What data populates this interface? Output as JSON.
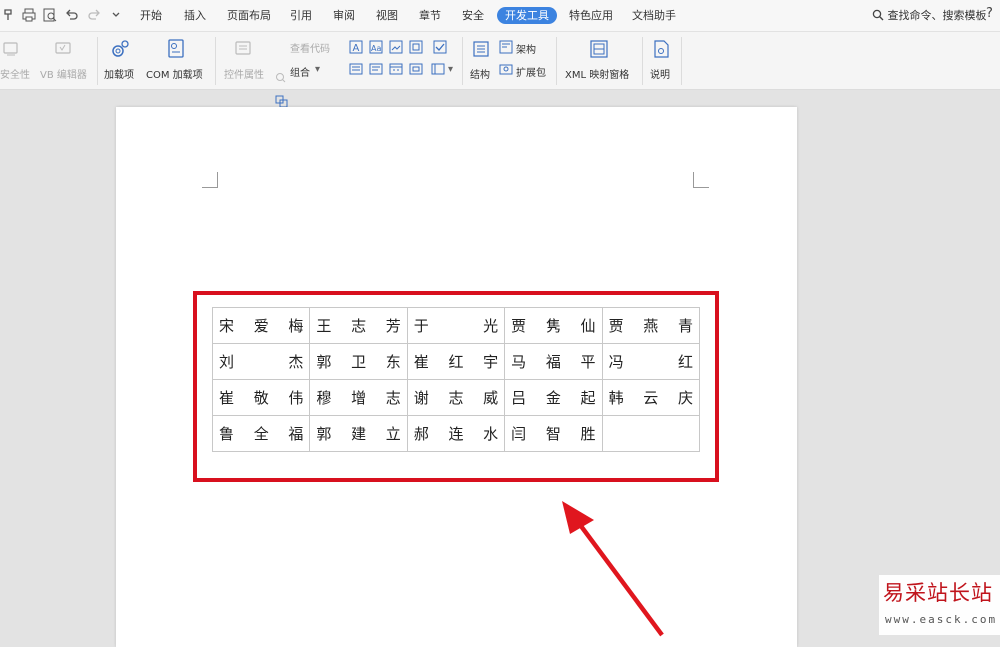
{
  "menu": {
    "tabs": [
      "开始",
      "插入",
      "页面布局",
      "引用",
      "审阅",
      "视图",
      "章节",
      "安全",
      "开发工具",
      "特色应用",
      "文档助手"
    ],
    "active_tab": "开发工具",
    "search": "查找命令、搜索模板",
    "help": "?"
  },
  "ribbon": {
    "security": "安全性",
    "vb_editor": "VB 编辑器",
    "addins": "加载项",
    "com_addins": "COM 加载项",
    "control_props": "控件属性",
    "view_code": "查看代码",
    "group": "组合",
    "structure": "结构",
    "schema": "架构",
    "expansion": "扩展包",
    "xml_pane": "XML 映射窗格",
    "help": "说明"
  },
  "table": {
    "rows": [
      [
        [
          "宋",
          "爱",
          "梅"
        ],
        [
          "王",
          "志",
          "芳"
        ],
        [
          "于",
          "",
          "光"
        ],
        [
          "贾",
          "隽",
          "仙"
        ],
        [
          "贾",
          "燕",
          "青"
        ]
      ],
      [
        [
          "刘",
          "",
          "杰"
        ],
        [
          "郭",
          "卫",
          "东"
        ],
        [
          "崔",
          "红",
          "宇"
        ],
        [
          "马",
          "福",
          "平"
        ],
        [
          "冯",
          "",
          "红"
        ]
      ],
      [
        [
          "崔",
          "敬",
          "伟"
        ],
        [
          "穆",
          "增",
          "志"
        ],
        [
          "谢",
          "志",
          "威"
        ],
        [
          "吕",
          "金",
          "起"
        ],
        [
          "韩",
          "云",
          "庆"
        ]
      ],
      [
        [
          "鲁",
          "全",
          "福"
        ],
        [
          "郭",
          "建",
          "立"
        ],
        [
          "郝",
          "连",
          "水"
        ],
        [
          "闫",
          "智",
          "胜"
        ],
        [
          "",
          "",
          ""
        ]
      ]
    ]
  },
  "watermark": {
    "main": "易采站长站",
    "sub": "www.easck.com"
  },
  "colors": {
    "accent": "#3c83e0",
    "highlight_red": "#d8101e"
  }
}
